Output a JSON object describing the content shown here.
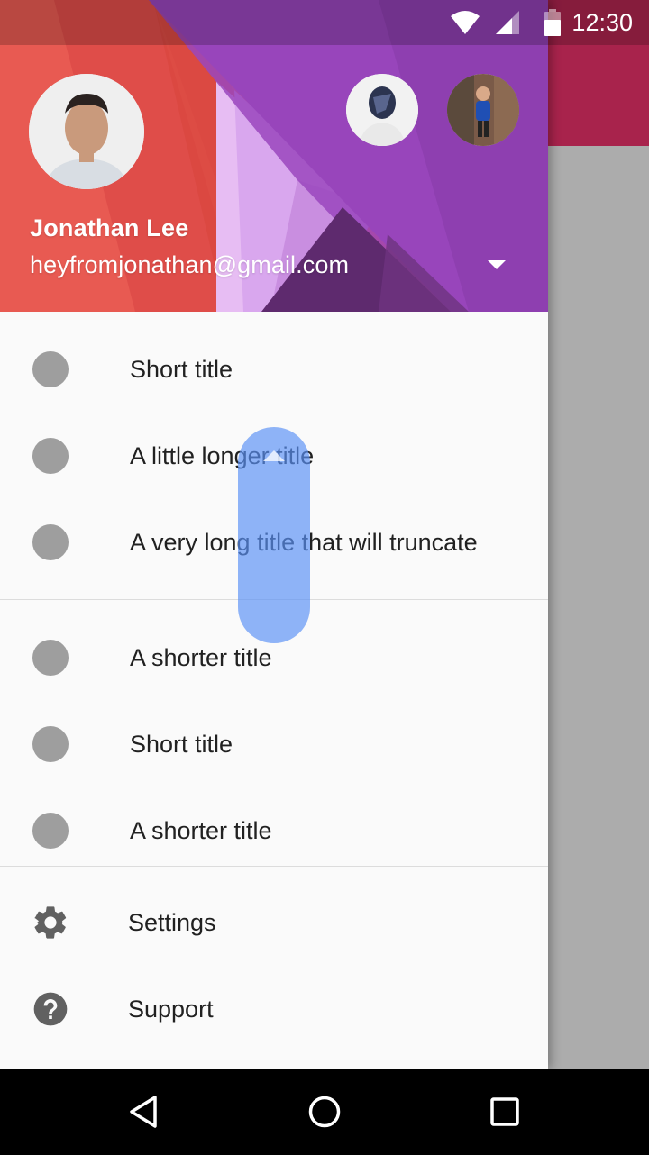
{
  "status_bar": {
    "time": "12:30",
    "icons": [
      "wifi-icon",
      "cell-signal-icon",
      "battery-icon"
    ]
  },
  "account": {
    "name": "Jonathan Lee",
    "email": "heyfromjonathan@gmail.com"
  },
  "nav_items": [
    {
      "label": "Short title",
      "icon": "circle-placeholder-icon"
    },
    {
      "label": "A little longer title",
      "icon": "circle-placeholder-icon"
    },
    {
      "label": "A very long title that will truncate",
      "icon": "circle-placeholder-icon"
    },
    {
      "label": "A shorter title",
      "icon": "circle-placeholder-icon"
    },
    {
      "label": "Short title",
      "icon": "circle-placeholder-icon"
    },
    {
      "label": "A shorter title",
      "icon": "circle-placeholder-icon"
    }
  ],
  "footer_items": [
    {
      "label": "Settings",
      "icon": "gear-icon"
    },
    {
      "label": "Support",
      "icon": "help-icon"
    }
  ],
  "colors": {
    "app_toolbar": "#a8234c",
    "header_red": "#e2524c",
    "header_purple": "#8e3fb0",
    "scroll_thumb": "#5a91f5",
    "placeholder_dot": "#9e9e9e"
  },
  "system_nav": [
    "back-icon",
    "home-icon",
    "recents-icon"
  ]
}
